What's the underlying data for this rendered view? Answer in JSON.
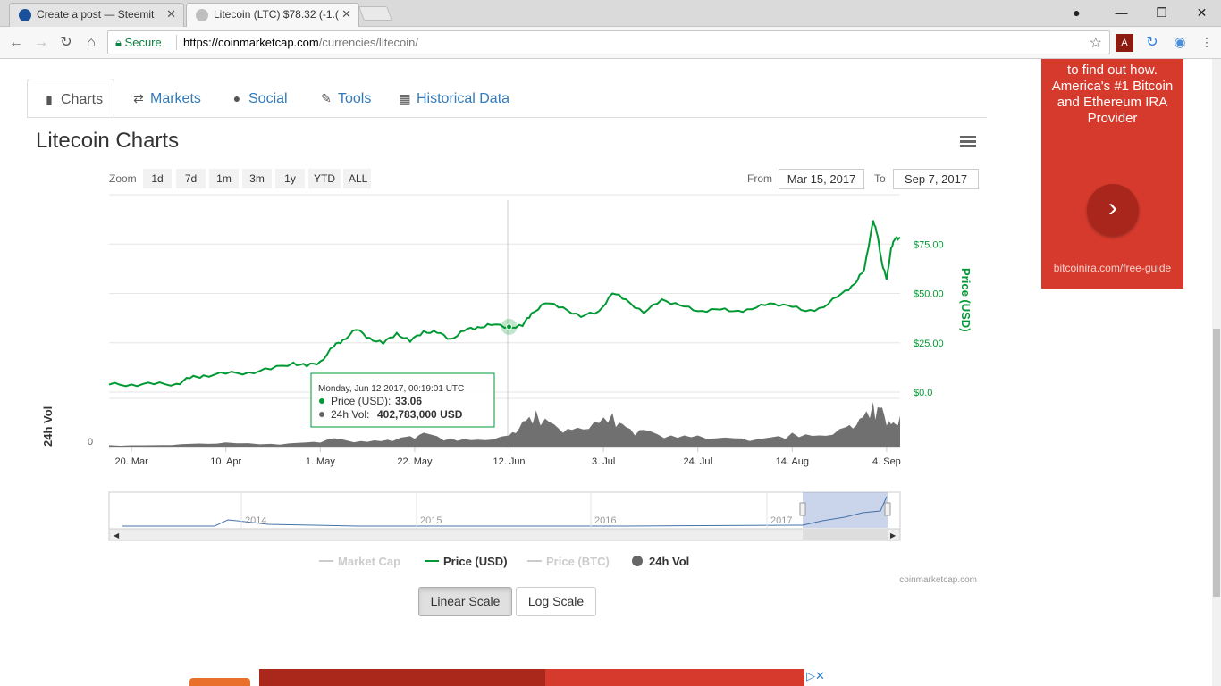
{
  "browser": {
    "tabs": [
      {
        "title": "Create a post — Steemit",
        "active": false
      },
      {
        "title": "Litecoin (LTC) $78.32 (-1.(",
        "active": true
      }
    ],
    "secure_label": "Secure",
    "url_host": "https://coinmarketcap.com",
    "url_path": "/currencies/litecoin/",
    "window_buttons": [
      "—",
      "❐",
      "✕"
    ]
  },
  "page": {
    "nav_tabs": [
      "Charts",
      "Markets",
      "Social",
      "Tools",
      "Historical Data"
    ],
    "charts_title": "Litecoin Charts",
    "zoom_label": "Zoom",
    "zoom_options": [
      "1d",
      "7d",
      "1m",
      "3m",
      "1y",
      "YTD",
      "ALL"
    ],
    "from_label": "From",
    "from_date": "Mar 15, 2017",
    "to_label": "To",
    "to_date": "Sep 7, 2017",
    "scale_buttons": {
      "linear": "Linear Scale",
      "log": "Log Scale"
    },
    "credit": "coinmarketcap.com"
  },
  "ad": {
    "text": "to find out how. America's #1 Bitcoin and Ethereum IRA Provider",
    "url": "bitcoinira.com/free-guide",
    "arrow": "›"
  },
  "chart_data": {
    "type": "line",
    "title": "Litecoin Charts",
    "x_ticks": [
      "20. Mar",
      "10. Apr",
      "1. May",
      "22. May",
      "12. Jun",
      "3. Jul",
      "24. Jul",
      "14. Aug",
      "4. Sep"
    ],
    "y_ticks": [
      "$0.0",
      "$25.00",
      "$50.00",
      "$75.00"
    ],
    "ylabel": "Price (USD)",
    "vol_axis_label": "24h Vol",
    "vol_axis_tick": "0",
    "ylim": [
      0,
      100
    ],
    "series": [
      {
        "name": "Price (USD)",
        "color": "#009933",
        "x": [
          "2017-03-15",
          "2017-03-20",
          "2017-03-25",
          "2017-03-30",
          "2017-04-02",
          "2017-04-05",
          "2017-04-10",
          "2017-04-15",
          "2017-04-20",
          "2017-04-25",
          "2017-04-28",
          "2017-05-01",
          "2017-05-04",
          "2017-05-06",
          "2017-05-09",
          "2017-05-12",
          "2017-05-15",
          "2017-05-18",
          "2017-05-21",
          "2017-05-24",
          "2017-05-27",
          "2017-05-30",
          "2017-06-02",
          "2017-06-05",
          "2017-06-08",
          "2017-06-12",
          "2017-06-15",
          "2017-06-17",
          "2017-06-20",
          "2017-06-24",
          "2017-06-28",
          "2017-07-02",
          "2017-07-05",
          "2017-07-08",
          "2017-07-12",
          "2017-07-16",
          "2017-07-20",
          "2017-07-24",
          "2017-07-28",
          "2017-08-01",
          "2017-08-05",
          "2017-08-09",
          "2017-08-13",
          "2017-08-17",
          "2017-08-21",
          "2017-08-25",
          "2017-08-28",
          "2017-08-30",
          "2017-09-01",
          "2017-09-02",
          "2017-09-03",
          "2017-09-04",
          "2017-09-05",
          "2017-09-06",
          "2017-09-07"
        ],
        "values": [
          3.8,
          3.9,
          4.0,
          4.2,
          7.0,
          8.5,
          9.3,
          10.0,
          11.5,
          15.0,
          13.0,
          15.5,
          23.0,
          26.5,
          31.5,
          27.5,
          24.5,
          30.0,
          25.5,
          31.0,
          30.0,
          27.0,
          31.0,
          33.0,
          34.0,
          33.06,
          33.5,
          40.0,
          45.0,
          43.0,
          38.0,
          41.0,
          50.0,
          47.0,
          40.0,
          47.0,
          44.0,
          41.0,
          42.0,
          41.0,
          42.0,
          45.0,
          44.0,
          41.0,
          43.0,
          50.0,
          55.0,
          62.0,
          87.0,
          79.0,
          65.0,
          57.0,
          73.0,
          78.0,
          78.32
        ]
      },
      {
        "name": "Market Cap",
        "hidden": true
      },
      {
        "name": "Price (BTC)",
        "hidden": true
      },
      {
        "name": "24h Vol",
        "color": "#666666",
        "x": [
          "2017-03-15",
          "2017-03-25",
          "2017-04-02",
          "2017-04-10",
          "2017-04-20",
          "2017-04-28",
          "2017-05-04",
          "2017-05-10",
          "2017-05-16",
          "2017-05-20",
          "2017-05-24",
          "2017-05-30",
          "2017-06-05",
          "2017-06-12",
          "2017-06-15",
          "2017-06-18",
          "2017-06-22",
          "2017-06-26",
          "2017-07-01",
          "2017-07-05",
          "2017-07-08",
          "2017-07-12",
          "2017-07-18",
          "2017-07-24",
          "2017-08-01",
          "2017-08-08",
          "2017-08-14",
          "2017-08-20",
          "2017-08-26",
          "2017-08-29",
          "2017-09-01",
          "2017-09-03",
          "2017-09-05",
          "2017-09-07"
        ],
        "values": [
          0.05,
          0.05,
          0.1,
          0.15,
          0.1,
          0.15,
          0.3,
          0.2,
          0.25,
          0.35,
          0.5,
          0.3,
          0.25,
          0.4,
          0.9,
          1.3,
          0.8,
          0.6,
          0.9,
          1.2,
          0.7,
          0.6,
          0.4,
          0.4,
          0.3,
          0.3,
          0.5,
          0.4,
          0.7,
          1.0,
          1.6,
          1.4,
          0.8,
          1.1
        ]
      }
    ],
    "tooltip": {
      "header": "Monday, Jun 12 2017, 00:19:01 UTC",
      "price_label": "Price (USD):",
      "price_value": "33.06",
      "vol_label": "24h Vol:",
      "vol_value": "402,783,000 USD"
    },
    "navigator_years": [
      "2014",
      "2015",
      "2016",
      "2017"
    ],
    "legend": [
      "Market Cap",
      "Price (USD)",
      "Price (BTC)",
      "24h Vol"
    ],
    "legend_placement": "bottom-center",
    "grid": true
  }
}
